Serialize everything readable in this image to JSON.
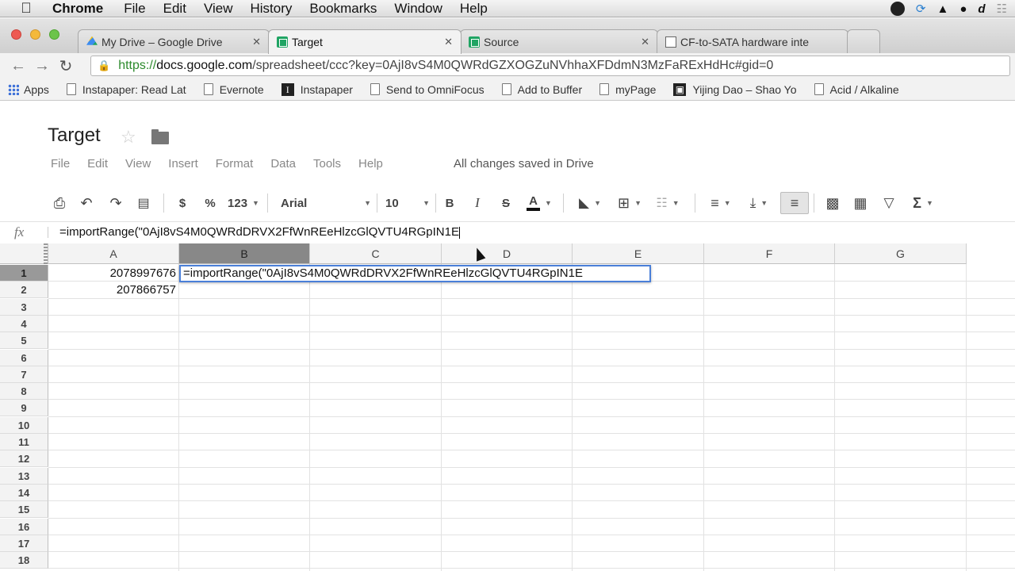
{
  "menubar": {
    "app": "Chrome",
    "items": [
      "File",
      "Edit",
      "View",
      "History",
      "Bookmarks",
      "Window",
      "Help"
    ]
  },
  "tabs": [
    {
      "label": "My Drive – Google Drive",
      "active": false
    },
    {
      "label": "Target",
      "active": true
    },
    {
      "label": "Source",
      "active": false
    },
    {
      "label": "CF-to-SATA hardware inte",
      "active": false
    }
  ],
  "address": {
    "scheme": "https://",
    "host": "docs.google.com",
    "path": "/spreadsheet/ccc?key=0AjI8vS4M0QWRdGZXOGZuNVhhaXFDdmN3MzFaRExHdHc#gid=0"
  },
  "bookmarks": [
    "Apps",
    "Instapaper: Read Lat",
    "Evernote",
    "Instapaper",
    "Send to OmniFocus",
    "Add to Buffer",
    "myPage",
    "Yijing Dao – Shao Yo",
    "Acid / Alkaline"
  ],
  "doc": {
    "title": "Target",
    "menu": [
      "File",
      "Edit",
      "View",
      "Insert",
      "Format",
      "Data",
      "Tools",
      "Help"
    ],
    "status": "All changes saved in Drive"
  },
  "format_toolbar": {
    "currency": "$",
    "percent": "%",
    "number_format": "123",
    "font": "Arial",
    "font_size": "10",
    "bold": "B",
    "italic": "I",
    "strike": "S",
    "text_color": "A",
    "functions": "Σ"
  },
  "formula_bar": {
    "fx": "fx",
    "content": "=importRange(\"0AjI8vS4M0QWRdDRVX2FfWnREeHlzcGlQVTU4RGpIN1E"
  },
  "sheet": {
    "columns": [
      "A",
      "B",
      "C",
      "D",
      "E",
      "F",
      "G"
    ],
    "rows": [
      "1",
      "2",
      "3",
      "4",
      "5",
      "6",
      "7",
      "8",
      "9",
      "10",
      "11",
      "12",
      "13",
      "14",
      "15",
      "16",
      "17",
      "18"
    ],
    "a1": "2078997676",
    "a2": "207866757",
    "editing": "=importRange(\"0AjI8vS4M0QWRdDRVX2FfWnREeHlzcGlQVTU4RGpIN1E"
  }
}
